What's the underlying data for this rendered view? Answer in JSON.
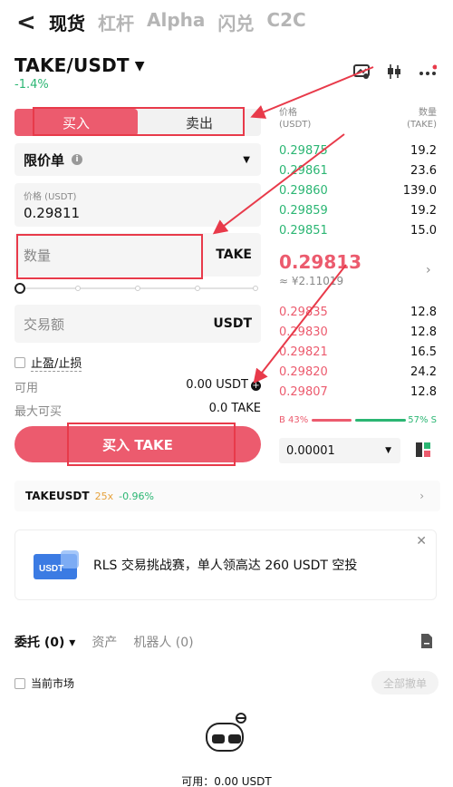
{
  "nav": {
    "back_label": "<",
    "tabs": [
      "现货",
      "杠杆",
      "Alpha",
      "闪兑",
      "C2C"
    ]
  },
  "pair": {
    "name": "TAKE/USDT",
    "change": "-1.4%"
  },
  "side_tabs": {
    "buy": "买入",
    "sell": "卖出"
  },
  "order_type": "限价单",
  "price": {
    "label": "价格 (USDT)",
    "value": "0.29811"
  },
  "quantity": {
    "placeholder": "数量",
    "unit": "TAKE"
  },
  "amount": {
    "placeholder": "交易额",
    "unit": "USDT"
  },
  "tpsl_label": "止盈/止损",
  "available": {
    "label": "可用",
    "value": "0.00 USDT"
  },
  "max_buy": {
    "label": "最大可买",
    "value": "0.0 TAKE"
  },
  "buy_button": "买入 TAKE",
  "orderbook": {
    "price_header": "价格",
    "price_unit": "(USDT)",
    "qty_header": "数量",
    "qty_unit": "(TAKE)",
    "asks": [
      {
        "price": "0.29875",
        "qty": "19.2"
      },
      {
        "price": "0.29861",
        "qty": "23.6"
      },
      {
        "price": "0.29860",
        "qty": "139.0"
      },
      {
        "price": "0.29859",
        "qty": "19.2"
      },
      {
        "price": "0.29851",
        "qty": "15.0"
      }
    ],
    "last_price": "0.29813",
    "last_fiat": "≈ ¥2.11019",
    "bids": [
      {
        "price": "0.29835",
        "qty": "12.8"
      },
      {
        "price": "0.29830",
        "qty": "12.8"
      },
      {
        "price": "0.29821",
        "qty": "16.5"
      },
      {
        "price": "0.29820",
        "qty": "24.2"
      },
      {
        "price": "0.29807",
        "qty": "12.8"
      }
    ],
    "buy_ratio": "B 43%",
    "sell_ratio": "57% S",
    "tick_size": "0.00001"
  },
  "ticker": {
    "name": "TAKEUSDT",
    "leverage": "25x",
    "change": "-0.96%"
  },
  "banner": {
    "badge": "USDT",
    "text": "RLS 交易挑战赛，单人领高达 260 USDT 空投"
  },
  "orders_tabs": {
    "entrust": "委托 (0)",
    "assets": "资产",
    "robot": "机器人 (0)"
  },
  "current_market": "当前市场",
  "cancel_all": "全部撤单",
  "bottom_available": "可用：0.00 USDT",
  "colors": {
    "buy": "#ec5b6e",
    "sell": "#2bb673",
    "annotation": "#e83a4a"
  }
}
